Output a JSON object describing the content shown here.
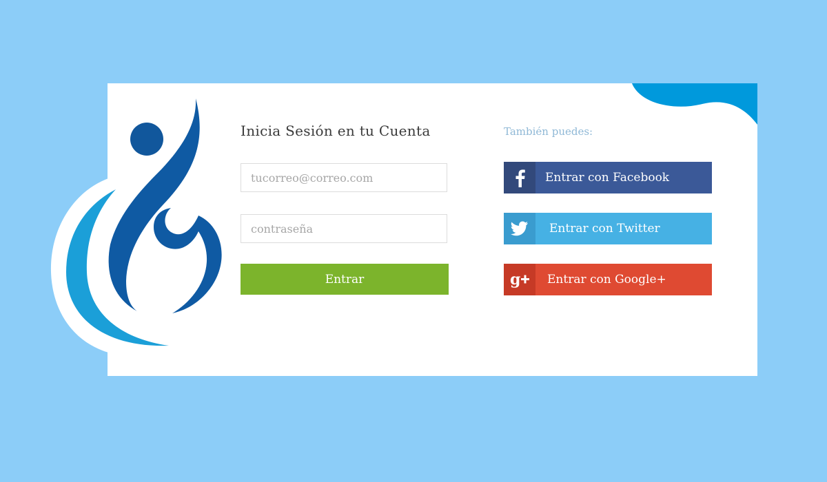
{
  "colors": {
    "background": "#8ccdf8",
    "accent_blue": "#0099dc",
    "login_green": "#7cb42c",
    "facebook": "#3b5998",
    "twitter": "#46b1e4",
    "google": "#df4a32"
  },
  "login": {
    "title": "Inicia Sesión en tu Cuenta",
    "email_placeholder": "tucorreo@correo.com",
    "password_placeholder": "contraseña",
    "submit_label": "Entrar"
  },
  "social": {
    "title": "También puedes:",
    "buttons": [
      {
        "label": "Entrar con Facebook",
        "icon": "facebook-icon"
      },
      {
        "label": "Entrar con Twitter",
        "icon": "twitter-icon"
      },
      {
        "label": "Entrar con Google+",
        "icon": "google-plus-icon"
      }
    ]
  }
}
